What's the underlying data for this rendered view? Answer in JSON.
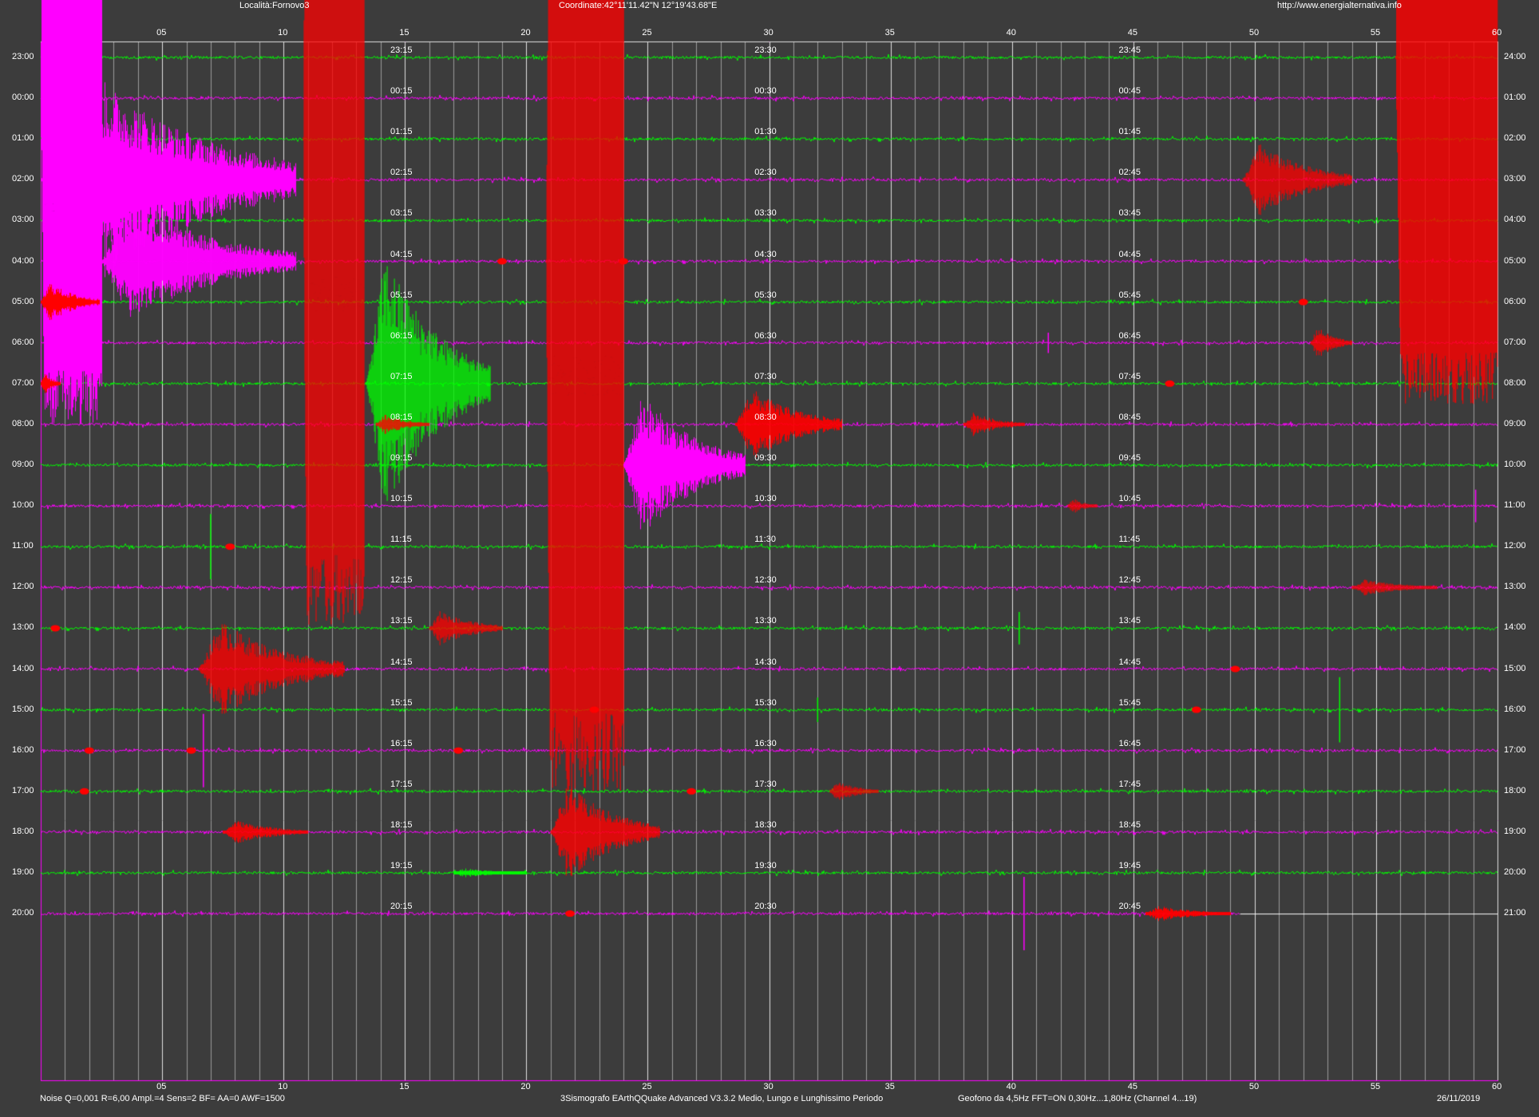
{
  "header": {
    "location": "Località:Fornovo3",
    "coordinates": "Coordinate:42°11'11.42\"N  12°19'43.68\"E",
    "url": "http://www.energialternativa.info"
  },
  "footer": {
    "settings": "Noise Q=0,001 R=6,00 Ampl.=4 Sens=2 BF= AA=0 AWF=1500",
    "software": "3Sismografo  EArthQQuake Advanced V3.3.2  Medio, Lungo e Lunghissimo Periodo",
    "sensor": "Geofono da 4,5Hz FFT=ON 0,30Hz...1,80Hz      (Channel 4...19)",
    "date": "26/11/2019"
  },
  "colors": {
    "background": "#3c3c3c",
    "trace_green": "#00ff00",
    "trace_magenta": "#ff00ff",
    "event_red": "#ff0000",
    "grid_major": "#e0e0e0",
    "grid_minor": "#9a9a9a",
    "frame": "#ff00ff",
    "text": "#ffffff"
  },
  "chart_data": {
    "type": "seismogram",
    "x_unit": "minutes",
    "xlim": [
      0,
      60
    ],
    "x_ticks": [
      "05",
      "10",
      "15",
      "20",
      "25",
      "30",
      "35",
      "40",
      "45",
      "50",
      "55",
      "60"
    ],
    "rows": [
      {
        "left": "23:00",
        "right": "24:00",
        "m15": "23:15",
        "m30": "23:30",
        "m45": "23:45",
        "color": "green"
      },
      {
        "left": "00:00",
        "right": "01:00",
        "m15": "00:15",
        "m30": "00:30",
        "m45": "00:45",
        "color": "magenta"
      },
      {
        "left": "01:00",
        "right": "02:00",
        "m15": "01:15",
        "m30": "01:30",
        "m45": "01:45",
        "color": "green"
      },
      {
        "left": "02:00",
        "right": "03:00",
        "m15": "02:15",
        "m30": "02:30",
        "m45": "02:45",
        "color": "magenta"
      },
      {
        "left": "03:00",
        "right": "04:00",
        "m15": "03:15",
        "m30": "03:30",
        "m45": "03:45",
        "color": "green"
      },
      {
        "left": "04:00",
        "right": "05:00",
        "m15": "04:15",
        "m30": "04:30",
        "m45": "04:45",
        "color": "magenta"
      },
      {
        "left": "05:00",
        "right": "06:00",
        "m15": "05:15",
        "m30": "05:30",
        "m45": "05:45",
        "color": "green"
      },
      {
        "left": "06:00",
        "right": "07:00",
        "m15": "06:15",
        "m30": "06:30",
        "m45": "06:45",
        "color": "magenta"
      },
      {
        "left": "07:00",
        "right": "08:00",
        "m15": "07:15",
        "m30": "07:30",
        "m45": "07:45",
        "color": "green"
      },
      {
        "left": "08:00",
        "right": "09:00",
        "m15": "08:15",
        "m30": "08:30",
        "m45": "08:45",
        "color": "magenta"
      },
      {
        "left": "09:00",
        "right": "10:00",
        "m15": "09:15",
        "m30": "09:30",
        "m45": "09:45",
        "color": "green"
      },
      {
        "left": "10:00",
        "right": "11:00",
        "m15": "10:15",
        "m30": "10:30",
        "m45": "10:45",
        "color": "magenta"
      },
      {
        "left": "11:00",
        "right": "12:00",
        "m15": "11:15",
        "m30": "11:30",
        "m45": "11:45",
        "color": "green"
      },
      {
        "left": "12:00",
        "right": "13:00",
        "m15": "12:15",
        "m30": "12:30",
        "m45": "12:45",
        "color": "magenta"
      },
      {
        "left": "13:00",
        "right": "14:00",
        "m15": "13:15",
        "m30": "13:30",
        "m45": "13:45",
        "color": "green"
      },
      {
        "left": "14:00",
        "right": "15:00",
        "m15": "14:15",
        "m30": "14:30",
        "m45": "14:45",
        "color": "magenta"
      },
      {
        "left": "15:00",
        "right": "16:00",
        "m15": "15:15",
        "m30": "15:30",
        "m45": "15:45",
        "color": "green"
      },
      {
        "left": "16:00",
        "right": "17:00",
        "m15": "16:15",
        "m30": "16:30",
        "m45": "16:45",
        "color": "magenta"
      },
      {
        "left": "17:00",
        "right": "18:00",
        "m15": "17:15",
        "m30": "17:30",
        "m45": "17:45",
        "color": "green"
      },
      {
        "left": "18:00",
        "right": "19:00",
        "m15": "18:15",
        "m30": "18:30",
        "m45": "18:45",
        "color": "magenta"
      },
      {
        "left": "19:00",
        "right": "20:00",
        "m15": "19:15",
        "m30": "19:30",
        "m45": "19:45",
        "color": "green"
      },
      {
        "left": "20:00",
        "right": "21:00",
        "m15": "20:15",
        "m30": "20:30",
        "m45": "20:45",
        "color": "magenta",
        "end_min": 49.4
      }
    ],
    "events": [
      {
        "row": 0,
        "start": 0.0,
        "end": 2.5,
        "height": 9,
        "color": "magenta"
      },
      {
        "row": 3,
        "start": 0.0,
        "end": 10.5,
        "height": 3.0,
        "color": "magenta"
      },
      {
        "row": 5,
        "start": 2.5,
        "end": 10.5,
        "height": 1.5,
        "color": "magenta"
      },
      {
        "row": 6,
        "start": 0.0,
        "end": 2.4,
        "height": 0.5,
        "color": "red"
      },
      {
        "row": 8,
        "start": 0.0,
        "end": 0.8,
        "height": 0.3,
        "color": "red"
      },
      {
        "row": 2,
        "start": 10.8,
        "end": 13.3,
        "height": 12,
        "color": "red"
      },
      {
        "row": 8,
        "start": 13.4,
        "end": 18.5,
        "height": 3.2,
        "color": "green"
      },
      {
        "row": 5,
        "start": 20.8,
        "end": 24.0,
        "height": 13,
        "color": "red"
      },
      {
        "row": 10,
        "start": 24.0,
        "end": 29.0,
        "height": 1.8,
        "color": "magenta"
      },
      {
        "row": 9,
        "start": 28.6,
        "end": 33.0,
        "height": 0.9,
        "color": "red"
      },
      {
        "row": 9,
        "start": 38.0,
        "end": 40.5,
        "height": 0.3,
        "color": "red"
      },
      {
        "row": 9,
        "start": 13.8,
        "end": 16.0,
        "height": 0.25,
        "color": "red"
      },
      {
        "row": 11,
        "start": 42.3,
        "end": 43.5,
        "height": 0.2,
        "color": "red"
      },
      {
        "row": 3,
        "start": 49.5,
        "end": 54.0,
        "height": 0.9,
        "color": "red"
      },
      {
        "row": 7,
        "start": 52.3,
        "end": 54.0,
        "height": 0.4,
        "color": "red"
      },
      {
        "row": 0,
        "start": 55.8,
        "end": 60.0,
        "height": 8.5,
        "color": "red"
      },
      {
        "row": 14,
        "start": 16.0,
        "end": 19.0,
        "height": 0.45,
        "color": "red"
      },
      {
        "row": 15,
        "start": 6.5,
        "end": 12.5,
        "height": 1.2,
        "color": "red"
      },
      {
        "row": 19,
        "start": 21.0,
        "end": 25.5,
        "height": 1.2,
        "color": "red"
      },
      {
        "row": 19,
        "start": 7.5,
        "end": 11.0,
        "height": 0.3,
        "color": "red"
      },
      {
        "row": 18,
        "start": 32.5,
        "end": 34.5,
        "height": 0.25,
        "color": "red"
      },
      {
        "row": 13,
        "start": 54.0,
        "end": 57.5,
        "height": 0.2,
        "color": "red"
      },
      {
        "row": 21,
        "start": 45.5,
        "end": 49.0,
        "height": 0.2,
        "color": "red"
      },
      {
        "row": 20,
        "start": 17.0,
        "end": 20.0,
        "height": 0.12,
        "color": "green"
      }
    ],
    "blips": [
      {
        "row": 6,
        "at": 52.0
      },
      {
        "row": 8,
        "at": 46.5
      },
      {
        "row": 12,
        "at": 7.8
      },
      {
        "row": 14,
        "at": 0.6
      },
      {
        "row": 16,
        "at": 22.8
      },
      {
        "row": 16,
        "at": 47.6
      },
      {
        "row": 17,
        "at": 2.0
      },
      {
        "row": 17,
        "at": 6.2
      },
      {
        "row": 17,
        "at": 17.2
      },
      {
        "row": 18,
        "at": 1.8
      },
      {
        "row": 18,
        "at": 26.8
      },
      {
        "row": 21,
        "at": 21.8
      },
      {
        "row": 5,
        "at": 19.0
      },
      {
        "row": 5,
        "at": 24.0
      },
      {
        "row": 15,
        "at": 49.2
      }
    ],
    "spikes": [
      {
        "row": 12,
        "at": 7.0,
        "height": 0.8
      },
      {
        "row": 17,
        "at": 6.7,
        "height": 0.9
      },
      {
        "row": 21,
        "at": 40.5,
        "height": 0.9
      },
      {
        "row": 16,
        "at": 53.5,
        "height": 0.8
      },
      {
        "row": 11,
        "at": 59.1,
        "height": 0.4
      },
      {
        "row": 14,
        "at": 40.3,
        "height": 0.4
      },
      {
        "row": 16,
        "at": 32.0,
        "height": 0.3
      },
      {
        "row": 7,
        "at": 41.5,
        "height": 0.25
      }
    ]
  }
}
